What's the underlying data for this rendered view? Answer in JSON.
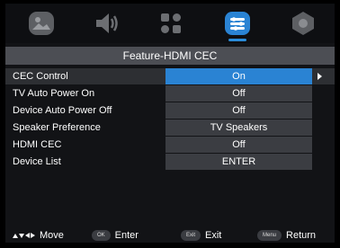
{
  "tabs": [
    {
      "icon": "picture-icon",
      "active": false
    },
    {
      "icon": "sound-icon",
      "active": false
    },
    {
      "icon": "channel-icon",
      "active": false
    },
    {
      "icon": "feature-icon",
      "active": true
    },
    {
      "icon": "settings-icon",
      "active": false
    }
  ],
  "header": {
    "title": "Feature-HDMI CEC"
  },
  "rows": [
    {
      "label": "CEC Control",
      "value": "On"
    },
    {
      "label": "TV Auto Power On",
      "value": "Off"
    },
    {
      "label": "Device Auto Power Off",
      "value": "Off"
    },
    {
      "label": "Speaker Preference",
      "value": "TV Speakers"
    },
    {
      "label": "HDMI CEC",
      "value": "Off"
    },
    {
      "label": "Device List",
      "value": "ENTER"
    }
  ],
  "footer": {
    "move_label": "Move",
    "ok_key": "OK",
    "enter_label": "Enter",
    "exit_key": "Exit",
    "exit_label": "Exit",
    "menu_key": "Menu",
    "return_label": "Return"
  },
  "colors": {
    "accent": "#2a83d3",
    "value_bg": "#3b3d42",
    "header_bg": "#4c4e54",
    "icon_gray": "#5d5f63"
  }
}
